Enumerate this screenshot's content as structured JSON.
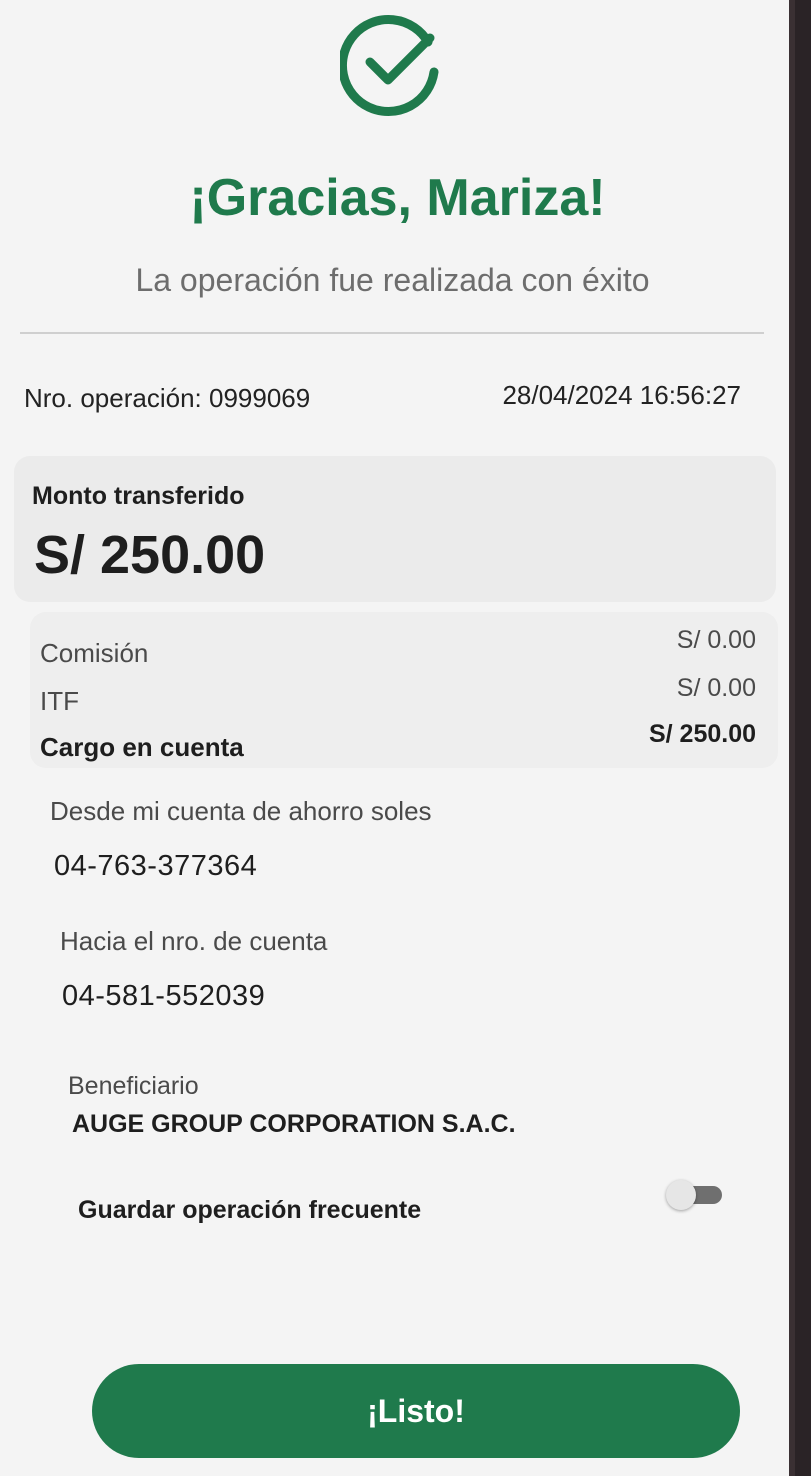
{
  "header": {
    "icon": "check-circle-icon",
    "title": "¡Gracias, Mariza!",
    "subtitle": "La operación fue realizada con éxito"
  },
  "operation": {
    "number_label": "Nro. operación: 0999069",
    "datetime": "28/04/2024 16:56:27"
  },
  "amount": {
    "label": "Monto transferido",
    "value": "S/ 250.00"
  },
  "fees": {
    "commission_label": "Comisión",
    "commission_value": "S/ 0.00",
    "itf_label": "ITF",
    "itf_value": "S/ 0.00",
    "charge_label": "Cargo en cuenta",
    "charge_value": "S/ 250.00"
  },
  "from": {
    "label": "Desde mi cuenta de ahorro soles",
    "account": "04-763-377364"
  },
  "to": {
    "label": "Hacia el nro. de cuenta",
    "account": "04-581-552039"
  },
  "beneficiary": {
    "label": "Beneficiario",
    "name": "AUGE GROUP CORPORATION S.A.C."
  },
  "save_frequent": {
    "label": "Guardar operación frecuente",
    "enabled": false
  },
  "button": {
    "label": "¡Listo!"
  },
  "colors": {
    "brand_green": "#1f7a4c"
  }
}
